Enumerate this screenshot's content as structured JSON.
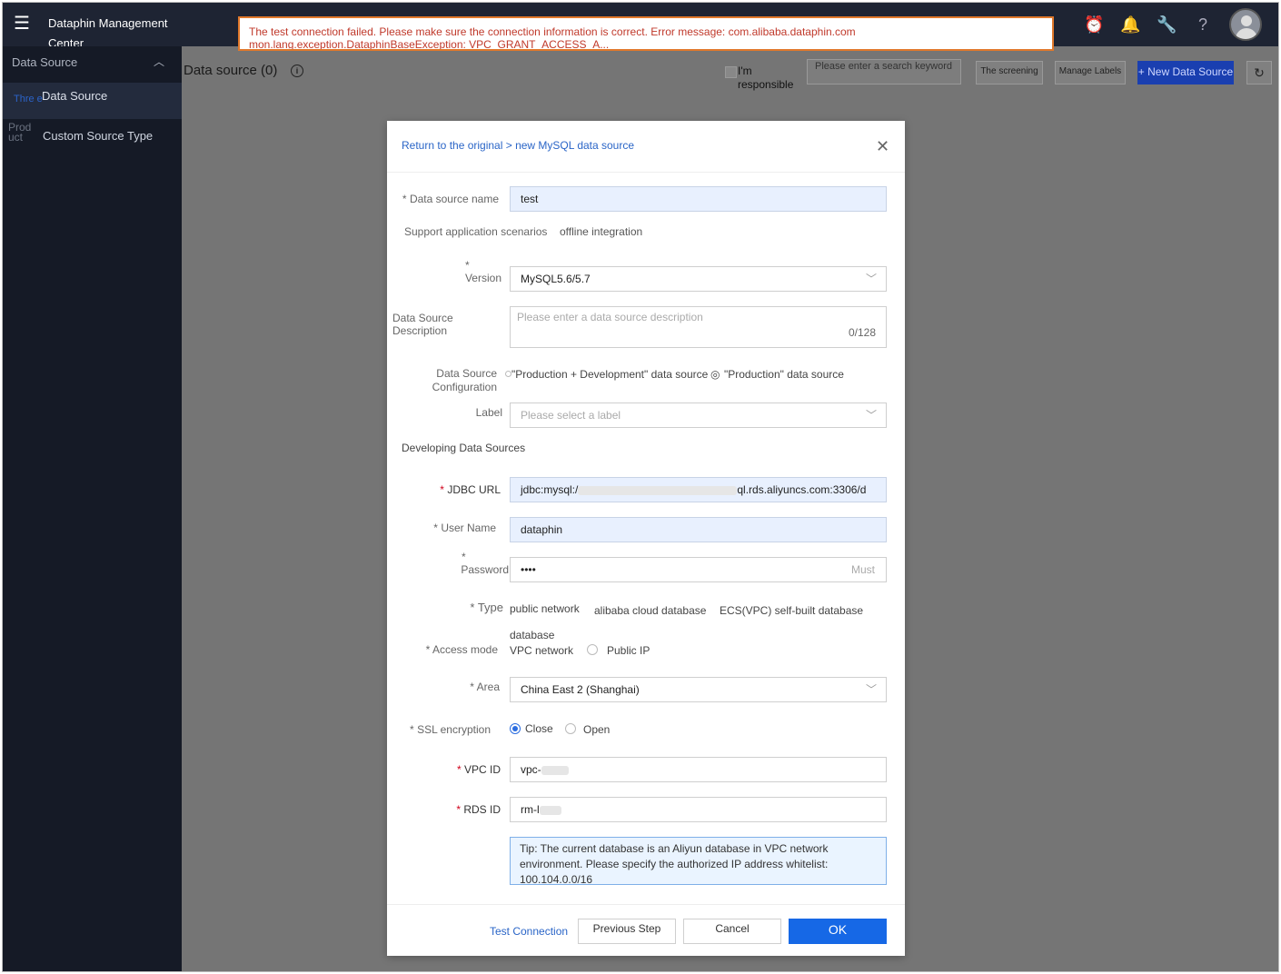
{
  "app": {
    "title": "Dataphin Management Center"
  },
  "error_banner": {
    "text": "The test connection failed. Please make sure the connection information is correct. Error message: com.alibaba.dataphin.com mon.lang.exception.DataphinBaseException: VPC_GRANT_ACCESS_A..."
  },
  "sidebar": {
    "group_label": "Data Source",
    "items": [
      {
        "label": "Data Source",
        "ghost": "Thre e"
      },
      {
        "label": "Custom Source Type",
        "ghost": "Prod uct"
      }
    ]
  },
  "page": {
    "title": "Data source (0)",
    "responsible_label": "I'm responsible",
    "search_placeholder": "Please enter a search keyword",
    "screening_label": "The screening",
    "manage_labels": "Manage Labels",
    "new_data_source": "+ New Data Source"
  },
  "modal": {
    "breadcrumb": "Return to the original > new MySQL data source",
    "fields": {
      "name_label": "Data source name",
      "name_value": "test",
      "scenarios_label": "Support application scenarios",
      "scenarios_value": "offline integration",
      "version_label": "Version",
      "version_value": "MySQL5.6/5.7",
      "desc_label": "Data Source Description",
      "desc_placeholder": "Please enter a data source description",
      "desc_counter": "0/128",
      "config_label": "Data Source Configuration",
      "config_opt1": "\"Production + Development\" data source",
      "config_opt2": "\"Production\" data source",
      "label_label": "Label",
      "label_placeholder": "Please select a label",
      "dev_section": "Developing Data Sources",
      "jdbc_label": "JDBC URL",
      "jdbc_prefix": "jdbc:mysql:/",
      "jdbc_suffix": "ql.rds.aliyuncs.com:3306/d",
      "user_label": "User Name",
      "user_value": "dataphin",
      "password_label": "Password",
      "password_value": "••••",
      "password_hint": "Must",
      "type_label": "Type",
      "type_opt1": "public network",
      "type_opt2": "alibaba cloud database",
      "type_opt3": "ECS(VPC) self-built database",
      "type_opt2_wrap": "database",
      "access_label": "Access mode",
      "access_opt1": "VPC network",
      "access_opt2": "Public IP",
      "area_label": "Area",
      "area_value": "China East 2 (Shanghai)",
      "ssl_label": "SSL encryption",
      "ssl_opt1": "Close",
      "ssl_opt2": "Open",
      "vpc_label": "VPC ID",
      "vpc_value": "vpc-",
      "rds_label": "RDS ID",
      "rds_value": "rm-l"
    },
    "tip": "Tip: The current database is an Aliyun database in VPC network environment. Please specify the authorized IP address whitelist: 100.104.0.0/16",
    "footer": {
      "test_connection": "Test Connection",
      "previous": "Previous Step",
      "cancel": "Cancel",
      "ok": "OK"
    }
  }
}
